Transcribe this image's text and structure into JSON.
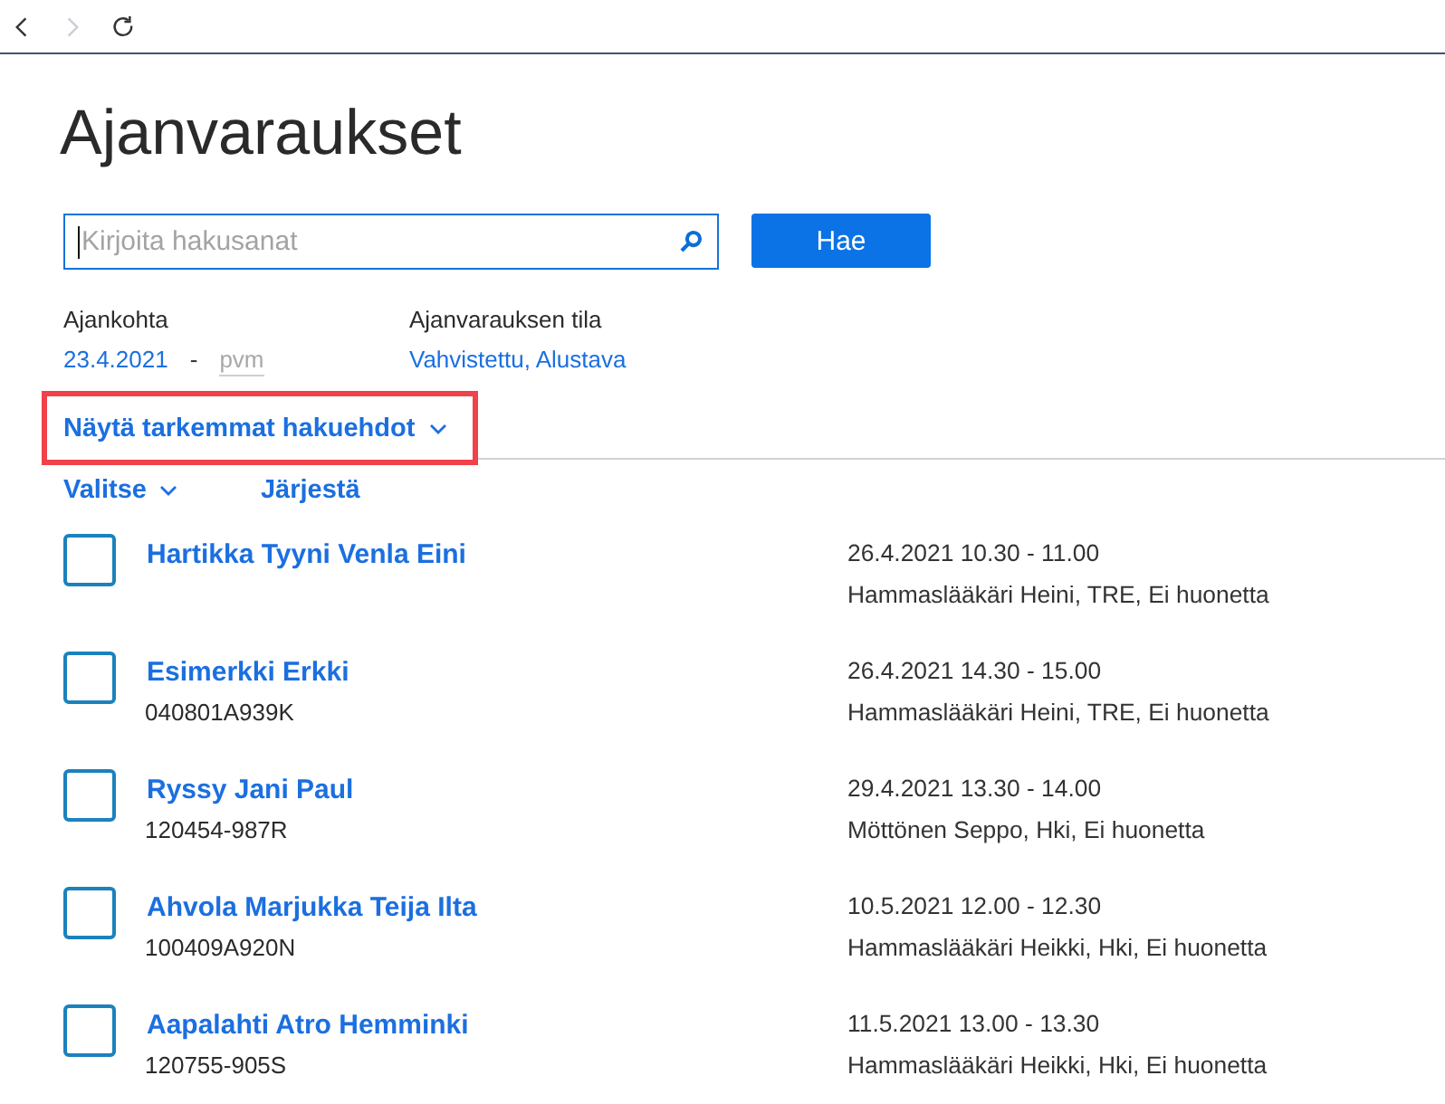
{
  "nav_buttons": [
    {
      "kind": "back",
      "disabled": false
    },
    {
      "kind": "forward",
      "disabled": true
    },
    {
      "kind": "reload",
      "disabled": false
    }
  ],
  "page_title": "Ajanvaraukset",
  "search": {
    "placeholder": "Kirjoita hakusanat",
    "focused": true,
    "button": "Hae"
  },
  "filters": [
    {
      "kind": "date_range",
      "label": "Ajankohta",
      "from": {
        "value": "23.4.2021"
      },
      "separator": "-",
      "to": {
        "placeholder": "pvm"
      }
    },
    {
      "kind": "value",
      "label": "Ajanvarauksen tila",
      "value": "Vahvistettu, Alustava"
    }
  ],
  "advanced_toggle": {
    "label": "Näytä tarkemmat hakuehdot",
    "highlighted": true
  },
  "list_actions": [
    {
      "label": "Valitse",
      "dropdown": true
    },
    {
      "label": "Järjestä",
      "dropdown": false
    }
  ],
  "appointments": [
    {
      "checked": false,
      "name": "Hartikka Tyyni Venla Eini",
      "time": "26.4.2021 10.30 - 11.00",
      "details": "Hammaslääkäri Heini, TRE, Ei huonetta"
    },
    {
      "checked": false,
      "name": "Esimerkki Erkki",
      "id": "040801A939K",
      "time": "26.4.2021 14.30 - 15.00",
      "details": "Hammaslääkäri Heini, TRE, Ei huonetta"
    },
    {
      "checked": false,
      "name": "Ryssy Jani Paul",
      "id": "120454-987R",
      "time": "29.4.2021 13.30 - 14.00",
      "details": "Möttönen Seppo, Hki, Ei huonetta"
    },
    {
      "checked": false,
      "name": "Ahvola Marjukka Teija Ilta",
      "id": "100409A920N",
      "time": "10.5.2021 12.00 - 12.30",
      "details": "Hammaslääkäri Heikki, Hki, Ei huonetta"
    },
    {
      "checked": false,
      "name": "Aapalahti Atro Hemminki",
      "id": "120755-905S",
      "time": "11.5.2021 13.00 - 13.30",
      "details": "Hammaslääkäri Heikki, Hki, Ei huonetta"
    }
  ]
}
